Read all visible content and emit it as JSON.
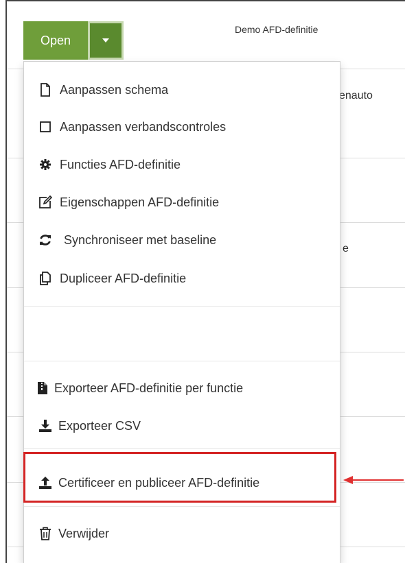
{
  "toolbar": {
    "open_label": "Open",
    "definition_name": "Demo AFD-definitie"
  },
  "background_rows": [
    {
      "text": "enauto"
    },
    {
      "text": "e"
    }
  ],
  "menu": {
    "items": [
      {
        "label": "Aanpassen schema",
        "icon": "file-icon"
      },
      {
        "label": "Aanpassen verbandscontroles",
        "icon": "square-icon"
      },
      {
        "label": "Functies AFD-definitie",
        "icon": "gear-icon"
      },
      {
        "label": "Eigenschappen AFD-definitie",
        "icon": "edit-icon"
      },
      {
        "label": "Synchroniseer met baseline",
        "icon": "sync-icon"
      },
      {
        "label": "Dupliceer AFD-definitie",
        "icon": "copy-icon"
      },
      {
        "label": "Exporteer AFD-definitie per functie",
        "icon": "file-archive-icon"
      },
      {
        "label": "Exporteer CSV",
        "icon": "download-icon"
      },
      {
        "label": "Certificeer en publiceer AFD-definitie",
        "icon": "upload-icon"
      },
      {
        "label": "Verwijder",
        "icon": "trash-icon"
      }
    ]
  },
  "colors": {
    "button_green": "#6f9e3a",
    "caret_green": "#5a8a2e",
    "highlight_red": "#d42424"
  }
}
